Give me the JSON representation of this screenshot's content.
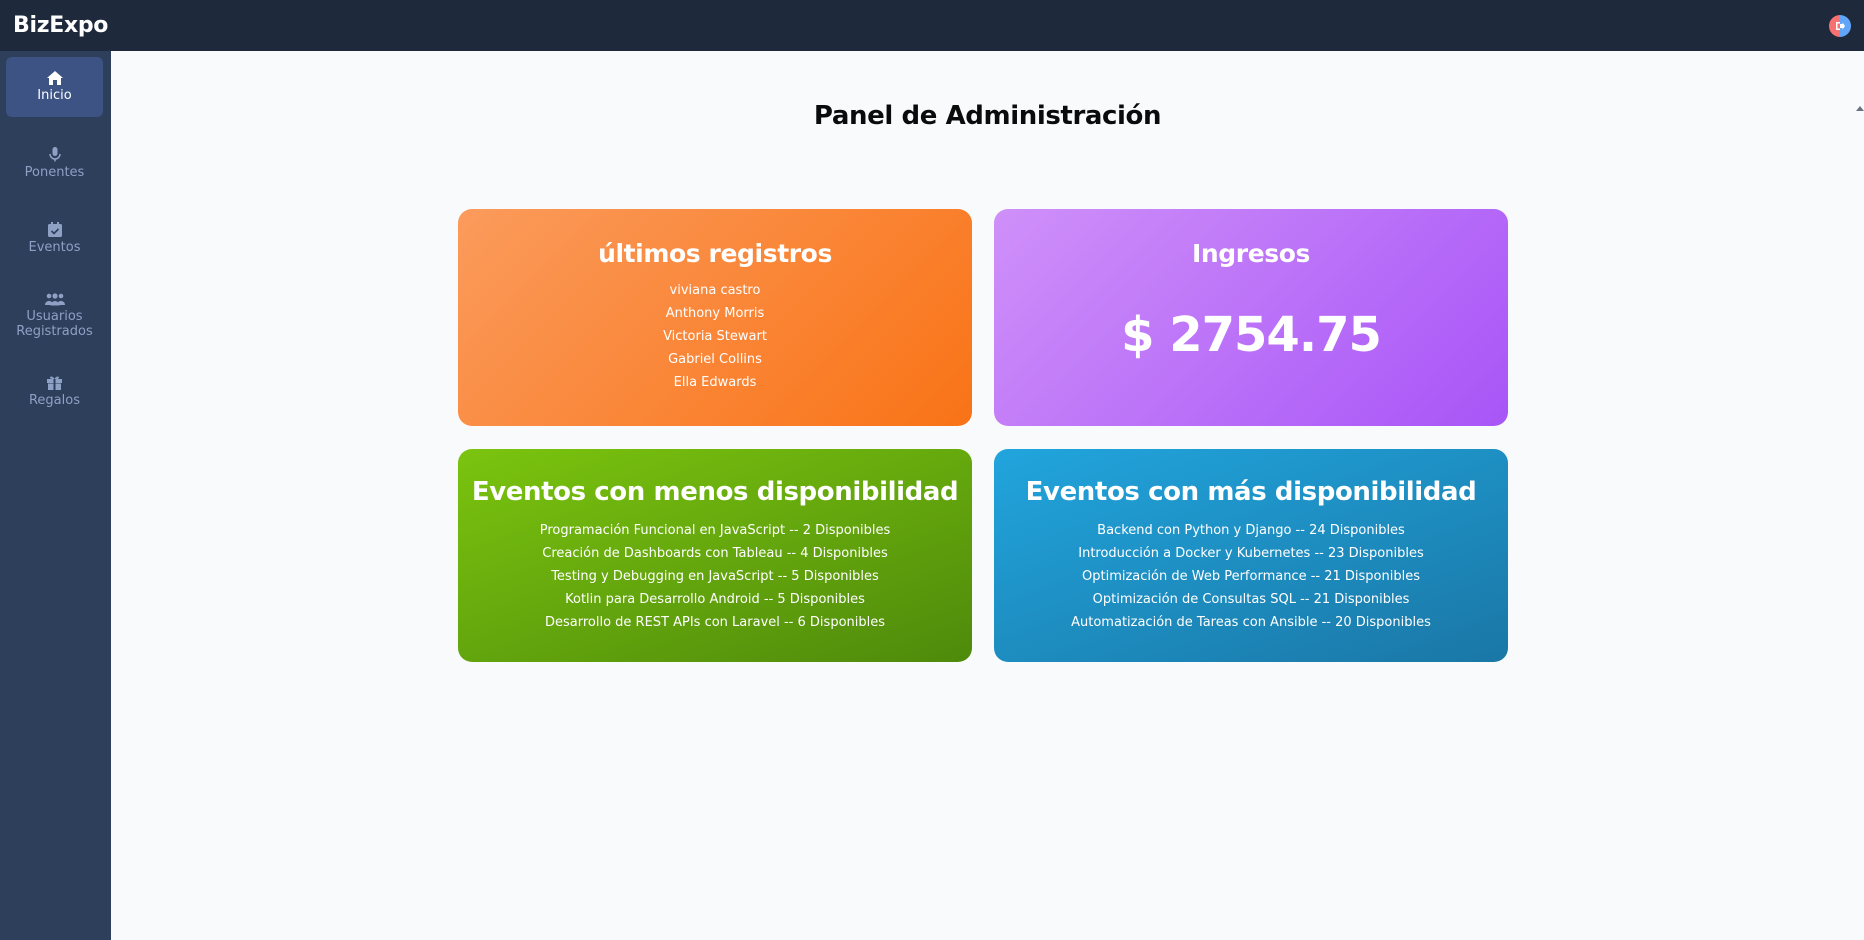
{
  "app": {
    "brand": "BizExpo"
  },
  "sidebar": {
    "items": [
      {
        "label": "Inicio",
        "icon": "home-icon",
        "active": true
      },
      {
        "label": "Ponentes",
        "icon": "microphone-icon"
      },
      {
        "label": "Eventos",
        "icon": "calendar-check-icon"
      },
      {
        "label": "Usuarios\nRegistrados",
        "icon": "users-icon"
      },
      {
        "label": "Regalos",
        "icon": "gift-icon"
      }
    ]
  },
  "main": {
    "title": "Panel de Administración",
    "latest_registrations": {
      "title": "últimos registros",
      "names": [
        "viviana castro",
        "Anthony Morris",
        "Victoria Stewart",
        "Gabriel Collins",
        "Ella Edwards"
      ]
    },
    "income": {
      "title": "Ingresos",
      "amount": "$ 2754.75"
    },
    "least_available": {
      "title": "Eventos con menos disponibilidad",
      "events": [
        "Programación Funcional en JavaScript -- 2 Disponibles",
        "Creación de Dashboards con Tableau -- 4 Disponibles",
        "Testing y Debugging en JavaScript -- 5 Disponibles",
        "Kotlin para Desarrollo Android -- 5 Disponibles",
        "Desarrollo de REST APIs con Laravel -- 6 Disponibles"
      ]
    },
    "most_available": {
      "title": "Eventos con más disponibilidad",
      "events": [
        "Backend con Python y Django -- 24 Disponibles",
        "Introducción a Docker y Kubernetes -- 23 Disponibles",
        "Optimización de Web Performance -- 21 Disponibles",
        "Optimización de Consultas SQL -- 21 Disponibles",
        "Automatización de Tareas con Ansible -- 20 Disponibles"
      ]
    }
  },
  "colors": {
    "topbar": "#1e293b",
    "sidebar": "#2e3f5c",
    "sidebar_active": "#3d5384",
    "orange": "#f97316",
    "purple": "#a855f7",
    "green": "#65a30d",
    "blue": "#1e90c8"
  }
}
